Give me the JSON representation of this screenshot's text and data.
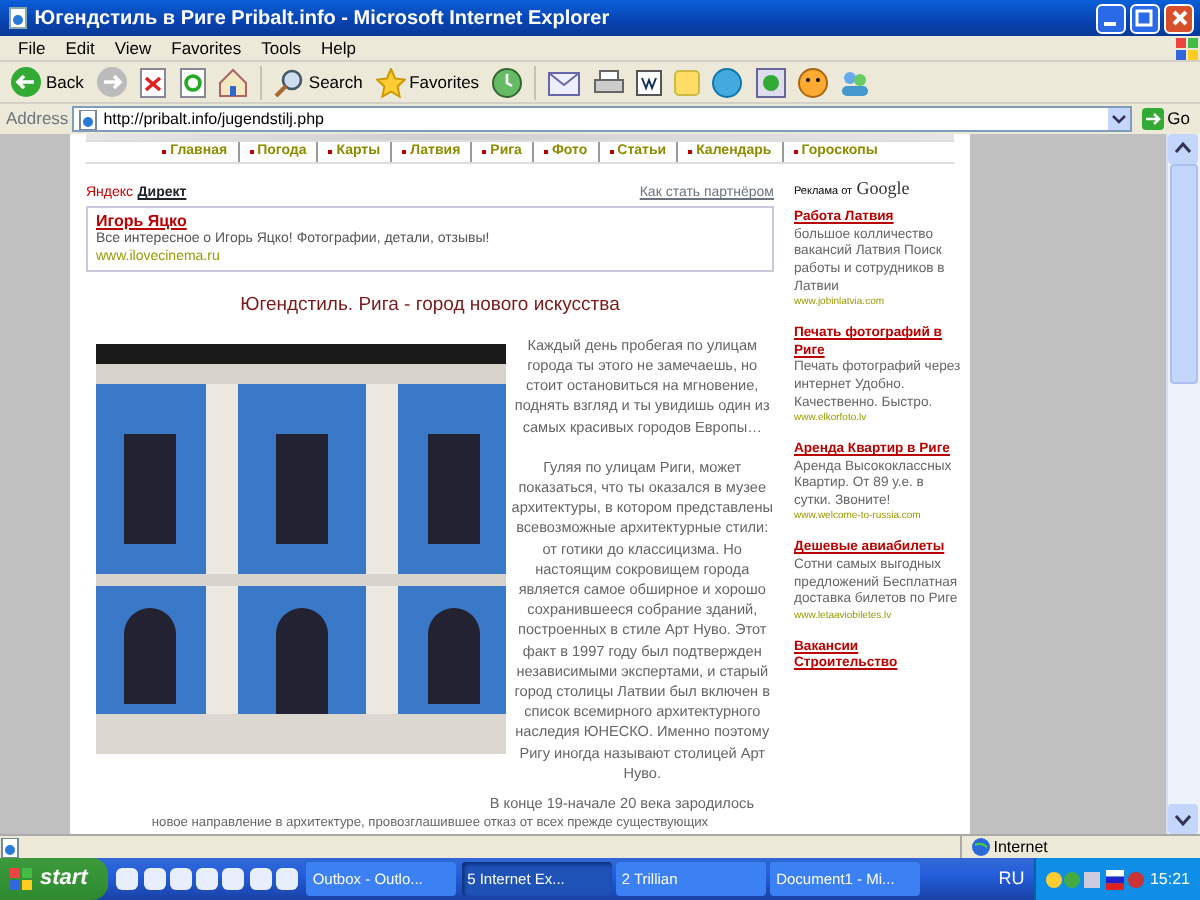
{
  "window": {
    "title": "Югендстиль в Риге Pribalt.info - Microsoft Internet Explorer"
  },
  "menu": [
    "File",
    "Edit",
    "View",
    "Favorites",
    "Tools",
    "Help"
  ],
  "toolbar": {
    "back": "Back",
    "search": "Search",
    "favorites": "Favorites"
  },
  "address_bar": {
    "label": "Address",
    "url": "http://pribalt.info/jugendstilj.php",
    "go": "Go"
  },
  "page": {
    "nav": [
      "Главная",
      "Погода",
      "Карты",
      "Латвия",
      "Рига",
      "Фото",
      "Статьи",
      "Календарь",
      "Гороскопы"
    ],
    "direct": {
      "brand": "Яндекс",
      "label": "Директ",
      "partner_link": "Как стать партнёром",
      "ad": {
        "title": "Игорь Яцко",
        "text": "Все интересное о Игорь Яцко! Фотографии, детали, отзывы!",
        "url": "www.ilovecinema.ru"
      }
    },
    "article": {
      "title": "Югендстиль. Рига - город нового искусства",
      "paragraphs": [
        "Каждый день пробегая по улицам города ты этого не замечаешь, но стоит остановиться на мгновение, поднять взгляд и ты увидишь один из самых красивых городов Европы…",
        "Гуляя по улицам Риги, может показаться, что ты оказался в музее архитектуры, в котором представлены всевозможные архитектурные стили: от готики до классицизма. Но настоящим сокровищем города является самое обширное и хорошо сохранившееся собрание зданий, построенных в стиле Арт Нуво. Этот факт в 1997 году был подтвержден независимыми экспертами, и старый город столицы Латвии был включен в список всемирного архитектурного наследия ЮНЕСКО. Именно поэтому Ригу иногда называют столицей Арт Нуво.",
        "В конце 19-начале 20 века зародилось",
        "новое направление в архитектуре, провозглашившее отказ от всех прежде существующих"
      ]
    },
    "google_ads": {
      "label": "Реклама от",
      "brand": "Google",
      "ads": [
        {
          "title": "Работа Латвия",
          "text": "большое колличество вакансий Латвия Поиск работы и сотрудников в Латвии",
          "url": "www.jobinlatvia.com"
        },
        {
          "title": "Печать фотографий в Риге",
          "text": "Печать фотографий через интернет Удобно. Качественно. Быстро.",
          "url": "www.elkorfoto.lv"
        },
        {
          "title": "Аренда Квартир в Риге",
          "text": "Аренда Высококлассных Квартир. От 89 у.е. в сутки. Звоните!",
          "url": "www.welcome-to-russia.com"
        },
        {
          "title": "Дешевые авиабилеты",
          "text": "Сотни самых выгодных предложений Бесплатная доставка билетов по Риге",
          "url": "www.letaaviobiletes.lv"
        },
        {
          "title": "Вакансии Строительство"
        }
      ]
    }
  },
  "status_bar": {
    "zone": "Internet"
  },
  "taskbar": {
    "start": "start",
    "tasks": [
      {
        "label": "Outbox - Outlo...",
        "selected": false
      },
      {
        "label": "5 Internet Ex...",
        "selected": true
      },
      {
        "label": "2 Trillian",
        "selected": false
      },
      {
        "label": "Document1 - Mi...",
        "selected": false
      }
    ],
    "language": "RU",
    "clock": "15:21"
  }
}
